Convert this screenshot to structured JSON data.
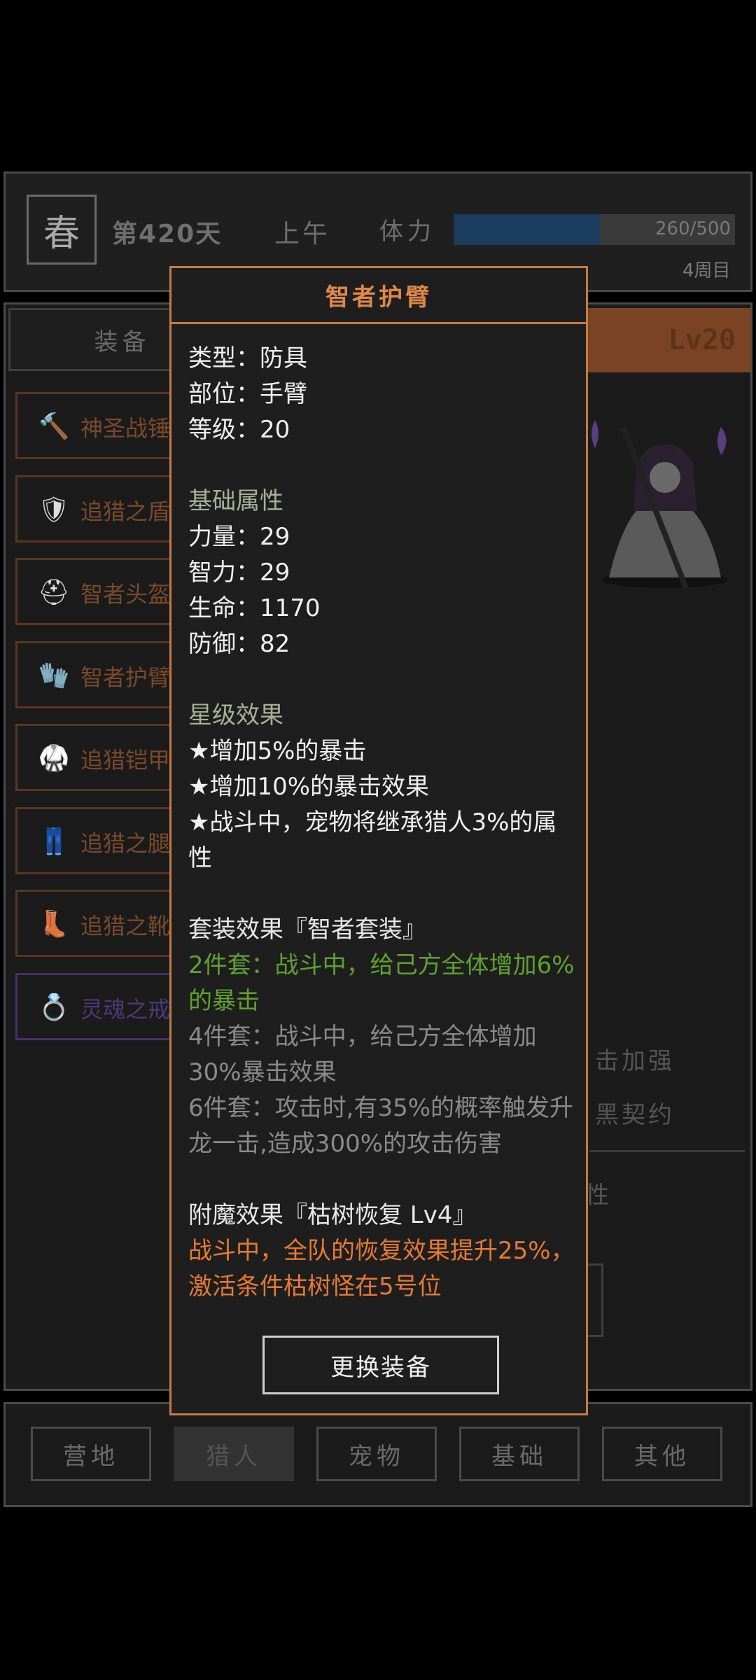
{
  "status": {
    "season": "春",
    "day": "第420天",
    "time_of_day": "上午",
    "stamina_label": "体力",
    "stamina_current": 260,
    "stamina_max": 500,
    "stamina_text": "260/500",
    "cycle": "4周目"
  },
  "tabs": {
    "equip": "装备"
  },
  "level": "Lv20",
  "equipment": [
    {
      "name": "神圣战锤",
      "icon": "hammer-icon",
      "glyph": "🔨"
    },
    {
      "name": "追猎之盾",
      "icon": "shield-icon",
      "glyph": "🛡"
    },
    {
      "name": "智者头盔",
      "icon": "helmet-icon",
      "glyph": "⛑"
    },
    {
      "name": "智者护臂",
      "icon": "bracer-icon",
      "glyph": "🧤"
    },
    {
      "name": "追猎铠甲",
      "icon": "armor-icon",
      "glyph": "🥋"
    },
    {
      "name": "追猎之腿",
      "icon": "legs-icon",
      "glyph": "👖"
    },
    {
      "name": "追猎之靴",
      "icon": "boots-icon",
      "glyph": "👢"
    },
    {
      "name": "灵魂之戒",
      "icon": "ring-icon",
      "glyph": "💍"
    }
  ],
  "right_panel": {
    "skill_1": "击加强",
    "skill_2": "黑契约",
    "stat_fragment": "性"
  },
  "nav": [
    "营地",
    "猎人",
    "宠物",
    "基础",
    "其他"
  ],
  "nav_active": 1,
  "popup": {
    "title": "智者护臂",
    "type": "类型：防具",
    "slot": "部位：手臂",
    "level": "等级：20",
    "base_header": "基础属性",
    "base_stats": [
      "力量：29",
      "智力：29",
      "生命：1170",
      "防御：82"
    ],
    "star_header": "星级效果",
    "star_effects": [
      "★增加5%的暴击",
      "★增加10%的暴击效果",
      "★战斗中，宠物将继承猎人3%的属性"
    ],
    "set_header": "套装效果『智者套装』",
    "set_2": "2件套：战斗中，给己方全体增加6%的暴击",
    "set_4": "4件套：战斗中，给己方全体增加30%暴击效果",
    "set_6": "6件套：攻击时,有35%的概率触发升龙一击,造成300%的攻击伤害",
    "enchant_header": "附魔效果『枯树恢复 Lv4』",
    "enchant_text": "战斗中，全队的恢复效果提升25%，激活条件枯树怪在5号位",
    "button": "更换装备"
  },
  "colors": {
    "accent_orange": "#c57a3f",
    "title_orange": "#e08848",
    "set_green": "#5fa12e",
    "enchant_orange": "#e57a34",
    "stamina_blue": "#1a3c5e"
  }
}
